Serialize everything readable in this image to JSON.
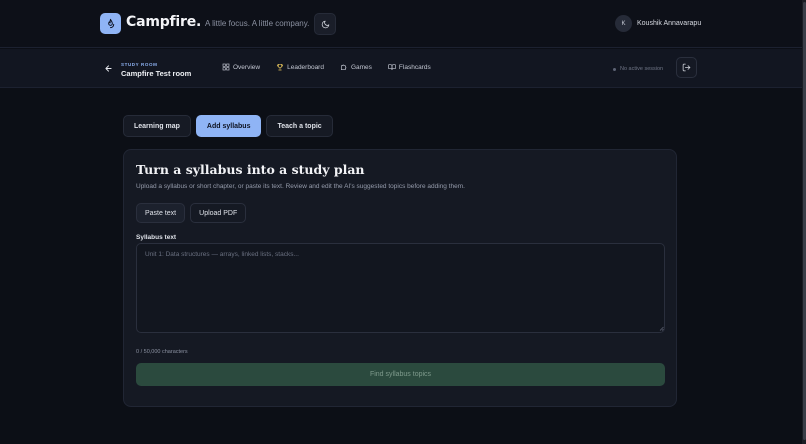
{
  "header": {
    "brand": "Campfire.",
    "tagline": "A little focus. A little company.",
    "user": {
      "initial": "K",
      "name": "Koushik Annavarapu"
    }
  },
  "room": {
    "label": "STUDY ROOM",
    "name": "Campfire Test room",
    "nav": [
      {
        "label": "Overview",
        "icon": "grid-icon"
      },
      {
        "label": "Leaderboard",
        "icon": "trophy-icon"
      },
      {
        "label": "Games",
        "icon": "puzzle-icon"
      },
      {
        "label": "Flashcards",
        "icon": "book-open-icon"
      }
    ],
    "session_status": "No active session"
  },
  "tabs": [
    {
      "label": "Learning map",
      "active": false
    },
    {
      "label": "Add syllabus",
      "active": true
    },
    {
      "label": "Teach a topic",
      "active": false
    }
  ],
  "card": {
    "title": "Turn a syllabus into a study plan",
    "description": "Upload a syllabus or short chapter, or paste its text. Review and edit the AI's suggested topics before adding them.",
    "modes": {
      "paste": "Paste text",
      "upload": "Upload PDF"
    },
    "field_label": "Syllabus text",
    "placeholder": "Unit 1: Data structures — arrays, linked lists, stacks...",
    "value": "",
    "char_count": "0 / 50,000 characters",
    "submit_label": "Find syllabus topics"
  },
  "colors": {
    "accent": "#8fb4f5",
    "background": "#0c0f16",
    "card": "#151923",
    "submit_disabled": "#2b4a3e"
  }
}
